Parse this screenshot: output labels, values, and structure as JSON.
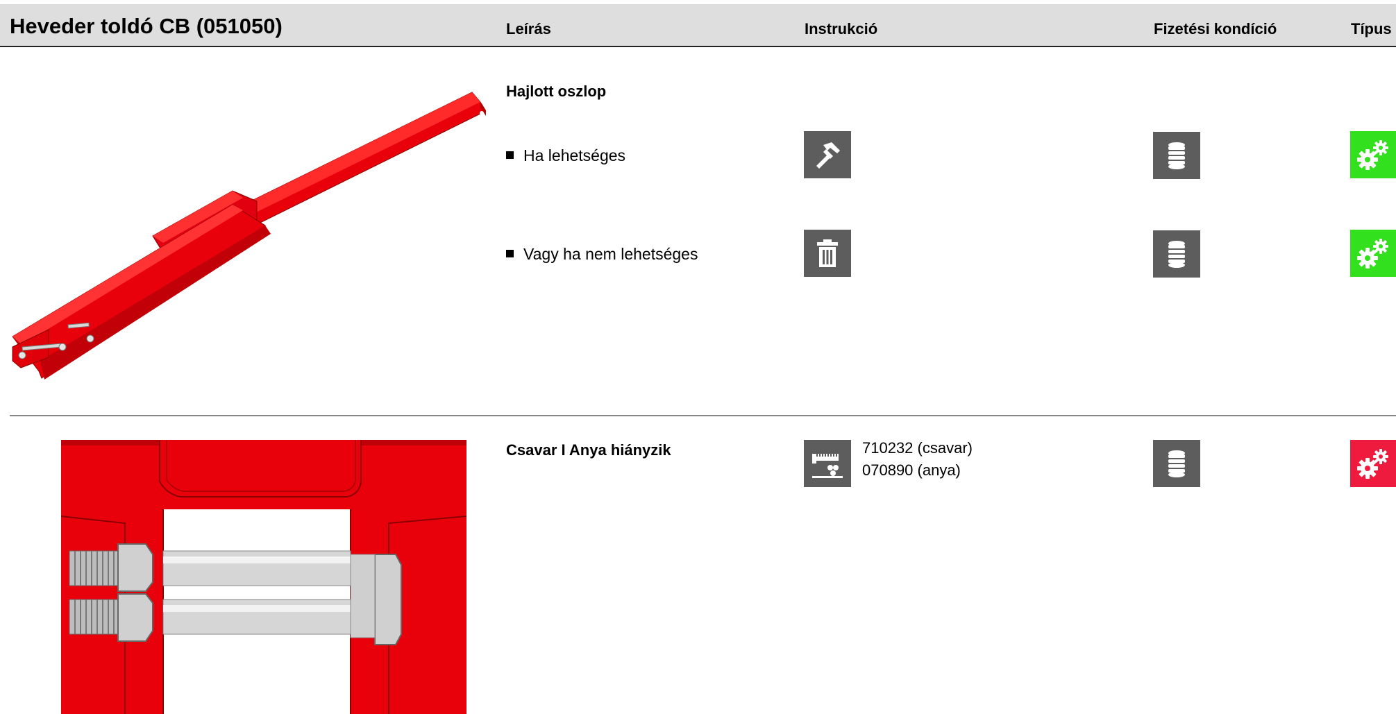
{
  "header": {
    "title": "Heveder toldó CB (051050)",
    "columns": {
      "leiras": "Leírás",
      "instrukcio": "Instrukció",
      "fizetesi": "Fizetési kondíció",
      "tipus": "Típus"
    }
  },
  "sections": [
    {
      "title": "Hajlott oszlop",
      "items": [
        {
          "label": "Ha lehetséges",
          "instruction_icon": "hammer-icon",
          "payment_icon": "coins-icon",
          "type_icon": "gears-icon",
          "type_color": "#33e01d"
        },
        {
          "label": "Vagy ha nem lehetséges",
          "instruction_icon": "trash-icon",
          "payment_icon": "coins-icon",
          "type_icon": "gears-icon",
          "type_color": "#33e01d"
        }
      ]
    },
    {
      "title": "Csavar I Anya hiányzik",
      "instruction_icon": "bolt-nut-parts-icon",
      "parts": [
        "710232 (csavar)",
        "070890 (anya)"
      ],
      "payment_icon": "coins-icon",
      "type_icon": "gears-icon",
      "type_color": "#ee1b3e"
    }
  ],
  "colors": {
    "header_bg": "#dedede",
    "icon_bg": "#5d5d5d",
    "type_ok": "#33e01d",
    "type_alert": "#ee1b3e",
    "part_red": "#e8000b"
  }
}
